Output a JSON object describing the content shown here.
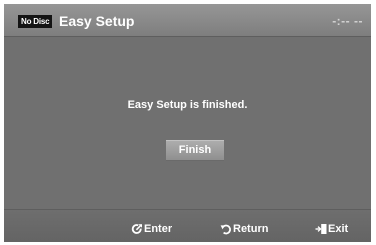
{
  "header": {
    "disc_status": "No Disc",
    "title": "Easy Setup",
    "time": "-:-- --"
  },
  "main": {
    "message": "Easy Setup is finished.",
    "finish_label": "Finish"
  },
  "footer": {
    "enter_label": "Enter",
    "return_label": "Return",
    "exit_label": "Exit",
    "enter_icon": "enter-icon",
    "return_icon": "return-icon",
    "exit_icon": "exit-icon"
  },
  "colors": {
    "background": "#707070",
    "header": "#8a8a8a",
    "button": "#a0a0a0",
    "text": "#ffffff"
  }
}
